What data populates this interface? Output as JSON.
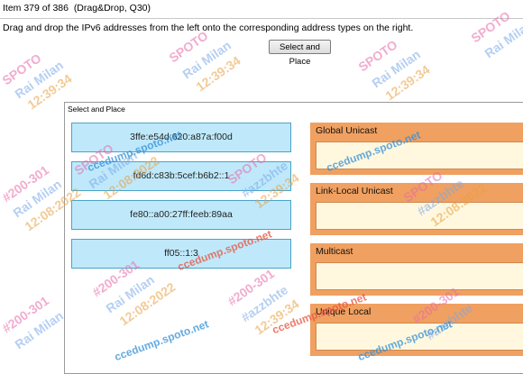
{
  "header": {
    "item_text": "Item 379 of 386",
    "item_type": "(Drag&Drop, Q30)"
  },
  "instruction": "Drag and drop the IPv6 addresses from the left onto the corresponding address types on the right.",
  "button_label": "Select and Place",
  "dialog_title": "Select and Place",
  "sources": [
    "3ffe:e54d:620:a87a:f00d",
    "fd6d:c83b:5cef:b6b2::1",
    "fe80::a00:27ff:feeb:89aa",
    "ff05::1:3"
  ],
  "categories": [
    "Global Unicast",
    "Link-Local Unicast",
    "Multicast",
    "Unique Local"
  ],
  "watermarks": {
    "tag": "SPOTO",
    "vendor": "#200-301",
    "name": "Rai Milan",
    "user": "#azzbhte",
    "date": "12:08:2022",
    "time": "12:39:34",
    "site": "ccedump.spoto.net"
  },
  "colors": {
    "source_fill": "#bfe9fb",
    "source_border": "#4aa3c8",
    "category_fill": "#f0a060",
    "drop_zone_fill": "#fff8df"
  }
}
